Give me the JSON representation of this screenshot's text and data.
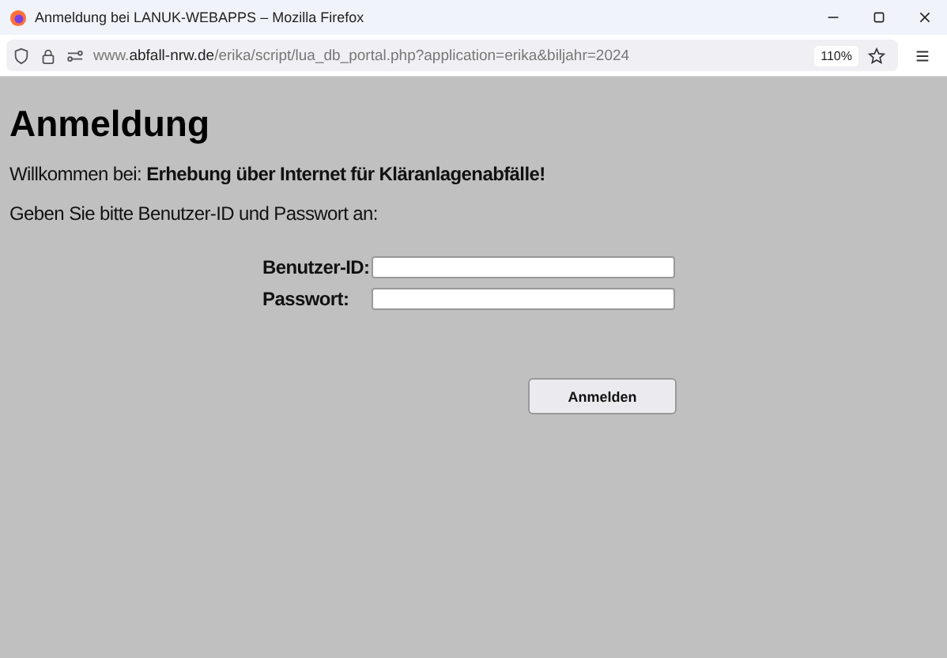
{
  "window": {
    "title": "Anmeldung bei LANUK-WEBAPPS – Mozilla Firefox"
  },
  "toolbar": {
    "url": "www.**abfall-nrw.de**/erika/script/lua_db_portal.php?application=erika&biljahr=2024",
    "zoom": "110%"
  },
  "page": {
    "heading": "Anmeldung",
    "welcome": "Willkommen bei: **Erhebung über Internet für Kläranlagenabfälle!**",
    "instruction": "Geben Sie bitte Benutzer-ID und Passwort an:",
    "fields": [
      {
        "label": "Benutzer-ID:"
      },
      {
        "label": "Passwort:"
      }
    ],
    "button": "Anmelden"
  }
}
